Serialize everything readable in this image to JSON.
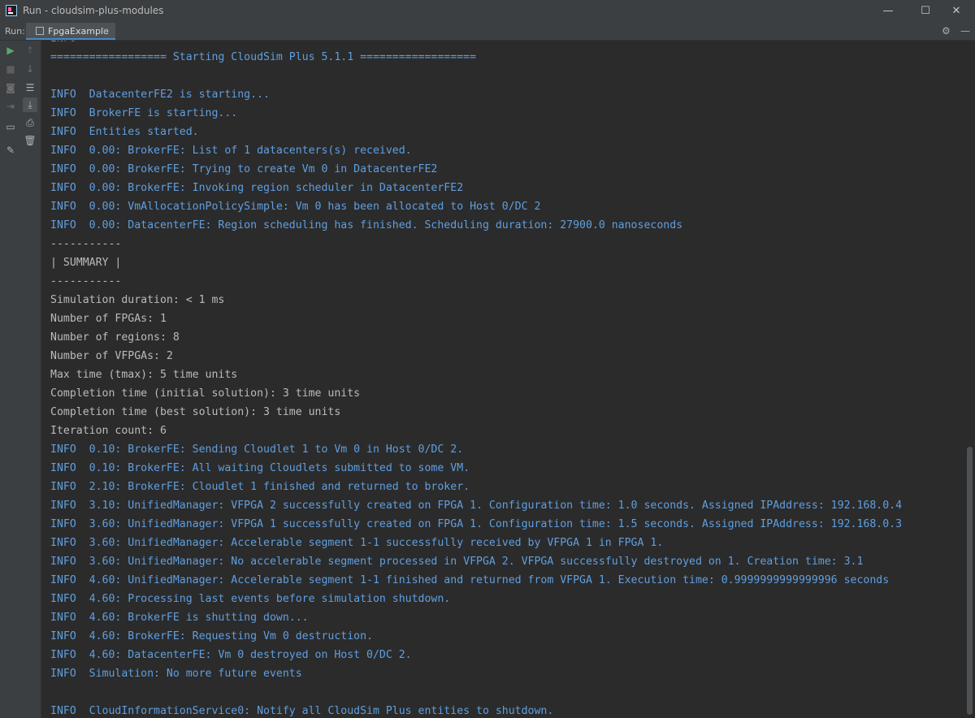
{
  "window": {
    "title": "Run - cloudsim-plus-modules",
    "minimize_glyph": "—",
    "maximize_glyph": "☐",
    "close_glyph": "✕"
  },
  "run_panel": {
    "label": "Run:",
    "tab_label": "FpgaExample",
    "tab_close_glyph": "×",
    "settings_glyph": "⚙",
    "hide_glyph": "—"
  },
  "sidebar_icons": {
    "rerun": "▶",
    "stop": "■",
    "camera": "◙",
    "exit": "⇥",
    "layout": "▭",
    "pin": "✎",
    "up": "↑",
    "down": "↓",
    "soft_wrap": "☰",
    "scroll_to_end": "⤓",
    "print": "⎙",
    "clear": "🗑"
  },
  "colors": {
    "log": "#5f9fe0",
    "output": "#bbbbbb",
    "background": "#2b2b2b",
    "chrome": "#3c3f41",
    "run_green": "#59a869"
  },
  "console": {
    "lines": [
      {
        "text": "INFO",
        "type": "log"
      },
      {
        "text": "================== Starting CloudSim Plus 5.1.1 ==================",
        "type": "log"
      },
      {
        "text": "",
        "type": "log"
      },
      {
        "text": "INFO  DatacenterFE2 is starting...",
        "type": "log"
      },
      {
        "text": "INFO  BrokerFE is starting...",
        "type": "log"
      },
      {
        "text": "INFO  Entities started.",
        "type": "log"
      },
      {
        "text": "INFO  0.00: BrokerFE: List of 1 datacenters(s) received.",
        "type": "log"
      },
      {
        "text": "INFO  0.00: BrokerFE: Trying to create Vm 0 in DatacenterFE2",
        "type": "log"
      },
      {
        "text": "INFO  0.00: BrokerFE: Invoking region scheduler in DatacenterFE2",
        "type": "log"
      },
      {
        "text": "INFO  0.00: VmAllocationPolicySimple: Vm 0 has been allocated to Host 0/DC 2",
        "type": "log"
      },
      {
        "text": "INFO  0.00: DatacenterFE: Region scheduling has finished. Scheduling duration: 27900.0 nanoseconds",
        "type": "log"
      },
      {
        "text": "-----------",
        "type": "out"
      },
      {
        "text": "| SUMMARY |",
        "type": "out"
      },
      {
        "text": "-----------",
        "type": "out"
      },
      {
        "text": "Simulation duration: < 1 ms",
        "type": "out"
      },
      {
        "text": "Number of FPGAs: 1",
        "type": "out"
      },
      {
        "text": "Number of regions: 8",
        "type": "out"
      },
      {
        "text": "Number of VFPGAs: 2",
        "type": "out"
      },
      {
        "text": "Max time (tmax): 5 time units",
        "type": "out"
      },
      {
        "text": "Completion time (initial solution): 3 time units",
        "type": "out"
      },
      {
        "text": "Completion time (best solution): 3 time units",
        "type": "out"
      },
      {
        "text": "Iteration count: 6",
        "type": "out"
      },
      {
        "text": "INFO  0.10: BrokerFE: Sending Cloudlet 1 to Vm 0 in Host 0/DC 2.",
        "type": "log"
      },
      {
        "text": "INFO  0.10: BrokerFE: All waiting Cloudlets submitted to some VM.",
        "type": "log"
      },
      {
        "text": "INFO  2.10: BrokerFE: Cloudlet 1 finished and returned to broker.",
        "type": "log"
      },
      {
        "text": "INFO  3.10: UnifiedManager: VFPGA 2 successfully created on FPGA 1. Configuration time: 1.0 seconds. Assigned IPAddress: 192.168.0.4",
        "type": "log"
      },
      {
        "text": "INFO  3.60: UnifiedManager: VFPGA 1 successfully created on FPGA 1. Configuration time: 1.5 seconds. Assigned IPAddress: 192.168.0.3",
        "type": "log"
      },
      {
        "text": "INFO  3.60: UnifiedManager: Accelerable segment 1-1 successfully received by VFPGA 1 in FPGA 1.",
        "type": "log"
      },
      {
        "text": "INFO  3.60: UnifiedManager: No accelerable segment processed in VFPGA 2. VFPGA successfully destroyed on 1. Creation time: 3.1",
        "type": "log"
      },
      {
        "text": "INFO  4.60: UnifiedManager: Accelerable segment 1-1 finished and returned from VFPGA 1. Execution time: 0.9999999999999996 seconds",
        "type": "log"
      },
      {
        "text": "INFO  4.60: Processing last events before simulation shutdown.",
        "type": "log"
      },
      {
        "text": "INFO  4.60: BrokerFE is shutting down...",
        "type": "log"
      },
      {
        "text": "INFO  4.60: BrokerFE: Requesting Vm 0 destruction.",
        "type": "log"
      },
      {
        "text": "INFO  4.60: DatacenterFE: Vm 0 destroyed on Host 0/DC 2.",
        "type": "log"
      },
      {
        "text": "INFO  Simulation: No more future events",
        "type": "log"
      },
      {
        "text": "",
        "type": "log"
      },
      {
        "text": "INFO  CloudInformationService0: Notify all CloudSim Plus entities to shutdown.",
        "type": "log"
      }
    ]
  }
}
